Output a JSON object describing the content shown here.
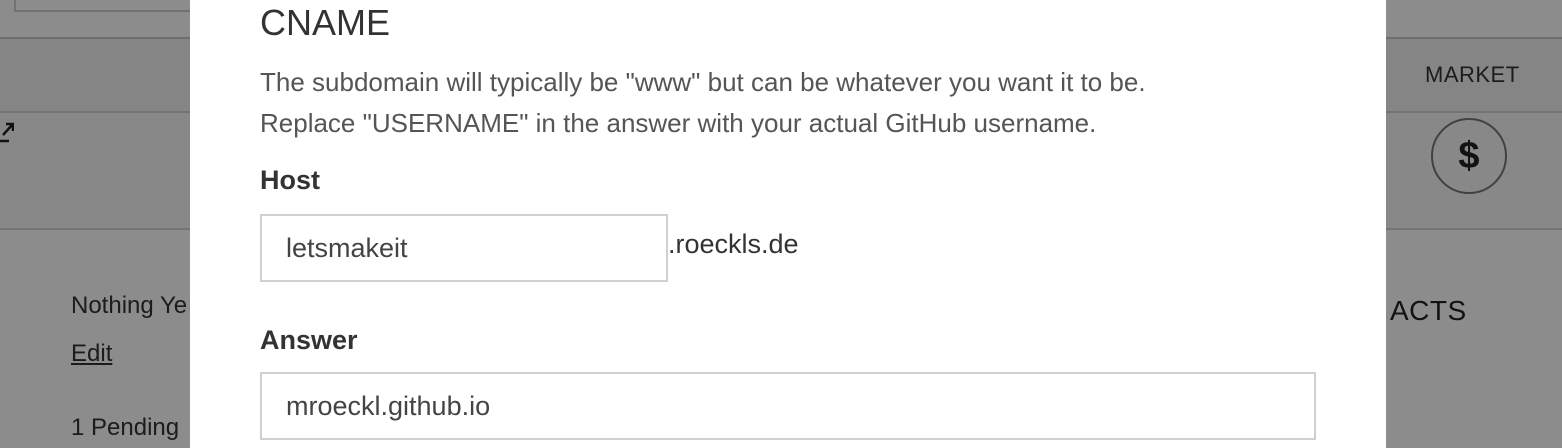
{
  "background": {
    "market_label": "MARKET",
    "dollar_glyph": "$",
    "nothing_text": "Nothing Ye",
    "edit_link": "Edit",
    "pending_text": "1 Pending",
    "contacts_heading": "ACTS",
    "icons": {
      "external_link": "external-link-icon",
      "dollar": "dollar-icon"
    }
  },
  "modal": {
    "title": "CNAME",
    "description_line1": "The subdomain will typically be \"www\" but can be whatever you want it to be.",
    "description_line2": "Replace \"USERNAME\" in the answer with your actual GitHub username.",
    "host": {
      "label": "Host",
      "value": "letsmakeit",
      "suffix": ".roeckls.de"
    },
    "answer": {
      "label": "Answer",
      "value": "mroeckl.github.io"
    }
  }
}
